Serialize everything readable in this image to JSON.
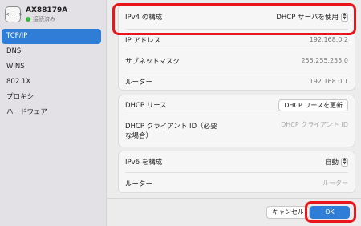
{
  "sidebar": {
    "device": {
      "icon_text": "<···>",
      "name": "AX88179A",
      "status": "接続済み",
      "status_color": "#38b63d"
    },
    "items": [
      {
        "label": "TCP/IP",
        "active": true
      },
      {
        "label": "DNS"
      },
      {
        "label": "WINS"
      },
      {
        "label": "802.1X"
      },
      {
        "label": "プロキシ"
      },
      {
        "label": "ハードウェア"
      }
    ]
  },
  "ipv4": {
    "label": "IPv4 の構成",
    "value": "DHCP サーバを使用",
    "chevron_up": "▲",
    "chevron_down": "▼"
  },
  "ipv4_details": {
    "ip_label": "IP アドレス",
    "ip_value": "192.168.0.2",
    "subnet_label": "サブネットマスク",
    "subnet_value": "255.255.255.0",
    "router_label": "ルーター",
    "router_value": "192.168.0.1"
  },
  "dhcp": {
    "lease_label": "DHCP リース",
    "renew_button": "DHCP リースを更新",
    "client_id_label_1": "DHCP クライアント ID（必要",
    "client_id_label_2": "な場合）",
    "client_id_placeholder": "DHCP クライアント ID"
  },
  "ipv6": {
    "label": "IPv6 を構成",
    "value": "自動",
    "chevron_up": "▲",
    "chevron_down": "▼",
    "router_label": "ルーター",
    "router_value": "ルーター"
  },
  "footer": {
    "cancel": "キャンセル",
    "ok": "OK"
  },
  "colors": {
    "accent": "#2f7dd6",
    "highlight": "#e8151b"
  }
}
